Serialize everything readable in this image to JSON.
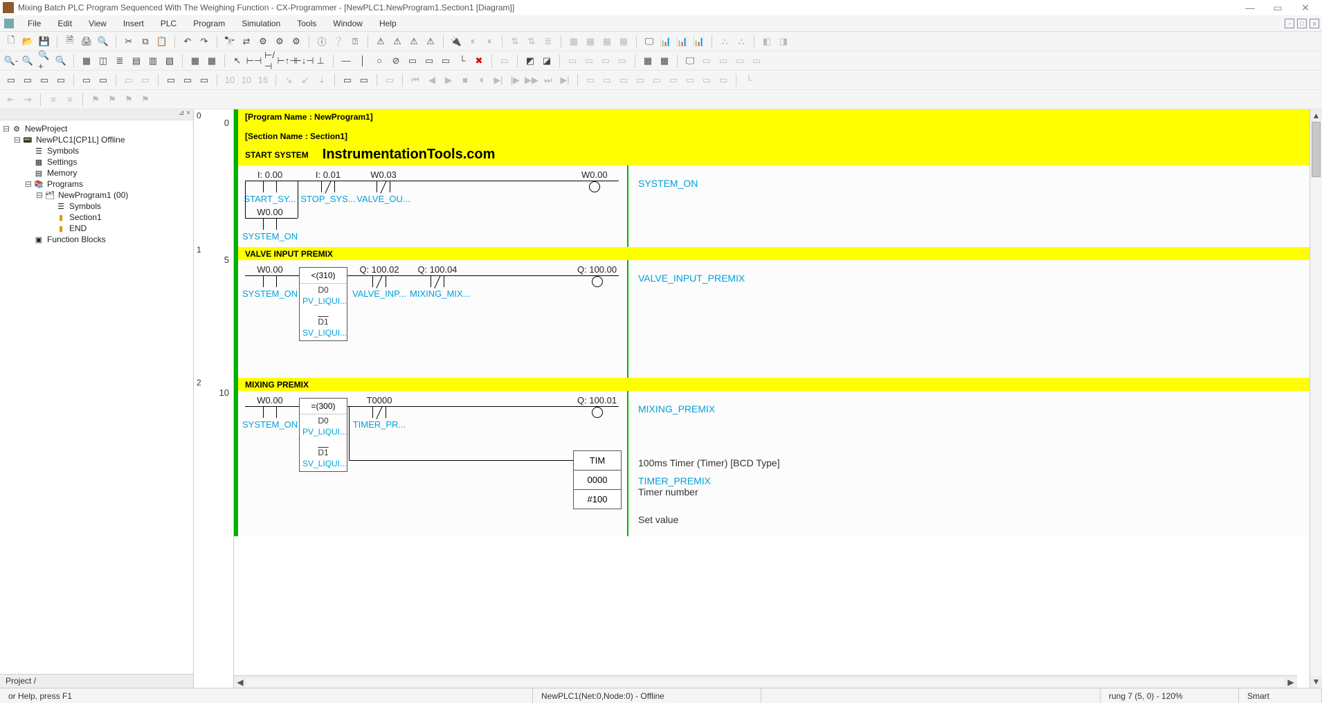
{
  "title": "Mixing Batch PLC Program Sequenced With The Weighing Function - CX-Programmer - [NewPLC1.NewProgram1.Section1 [Diagram]]",
  "menu": [
    "File",
    "Edit",
    "View",
    "Insert",
    "PLC",
    "Program",
    "Simulation",
    "Tools",
    "Window",
    "Help"
  ],
  "tree": {
    "root": "NewProject",
    "plc": "NewPLC1[CP1L] Offline",
    "items": [
      "Symbols",
      "Settings",
      "Memory",
      "Programs"
    ],
    "program": "NewProgram1 (00)",
    "progitems": [
      "Symbols",
      "Section1",
      "END"
    ],
    "fb": "Function Blocks",
    "tab": "Project"
  },
  "gutter": {
    "left": [
      "0",
      "1",
      "2"
    ],
    "right": [
      "0",
      "5",
      "10"
    ]
  },
  "header": {
    "prog": "[Program Name : NewProgram1]",
    "sect": "[Section Name : Section1]",
    "title0": "START SYSTEM",
    "watermark": "InstrumentationTools.com"
  },
  "rung0": {
    "c1_addr": "I: 0.00",
    "c1_lbl": "START_SY...",
    "c2_addr": "I: 0.01",
    "c2_lbl": "STOP_SYS...",
    "c3_addr": "W0.03",
    "c3_lbl": "VALVE_OU...",
    "coil_addr": "W0.00",
    "out": "SYSTEM_ON",
    "b1_addr": "W0.00",
    "b1_lbl": "SYSTEM_ON"
  },
  "rung1": {
    "title": "VALVE INPUT PREMIX",
    "c1_addr": "W0.00",
    "c1_lbl": "SYSTEM_ON",
    "fn_op": "<(310)",
    "fn_p1": "D0",
    "fn_p1l": "PV_LIQUI...",
    "fn_p2": "D1",
    "fn_p2l": "SV_LIQUI...",
    "c2_addr": "Q: 100.02",
    "c2_lbl": "VALVE_INP...",
    "c3_addr": "Q: 100.04",
    "c3_lbl": "MIXING_MIX...",
    "coil_addr": "Q: 100.00",
    "out": "VALVE_INPUT_PREMIX"
  },
  "rung2": {
    "title": "MIXING PREMIX",
    "c1_addr": "W0.00",
    "c1_lbl": "SYSTEM_ON",
    "fn_op": "=(300)",
    "fn_p1": "D0",
    "fn_p1l": "PV_LIQUI...",
    "fn_p2": "D1",
    "fn_p2l": "SV_LIQUI...",
    "c2_addr": "T0000",
    "c2_lbl": "TIMER_PR...",
    "coil_addr": "Q: 100.01",
    "out": "MIXING_PREMIX",
    "tim_name": "TIM",
    "tim_num": "0000",
    "tim_set": "#100",
    "tim_desc": "100ms Timer (Timer) [BCD Type]",
    "tim_lbl": "TIMER_PREMIX",
    "tim_numdesc": "Timer number",
    "tim_setdesc": "Set value"
  },
  "status": {
    "help": "or Help, press F1",
    "plc": "NewPLC1(Net:0,Node:0) - Offline",
    "rung": "rung 7 (5, 0)  - 120%",
    "mode": "Smart"
  }
}
